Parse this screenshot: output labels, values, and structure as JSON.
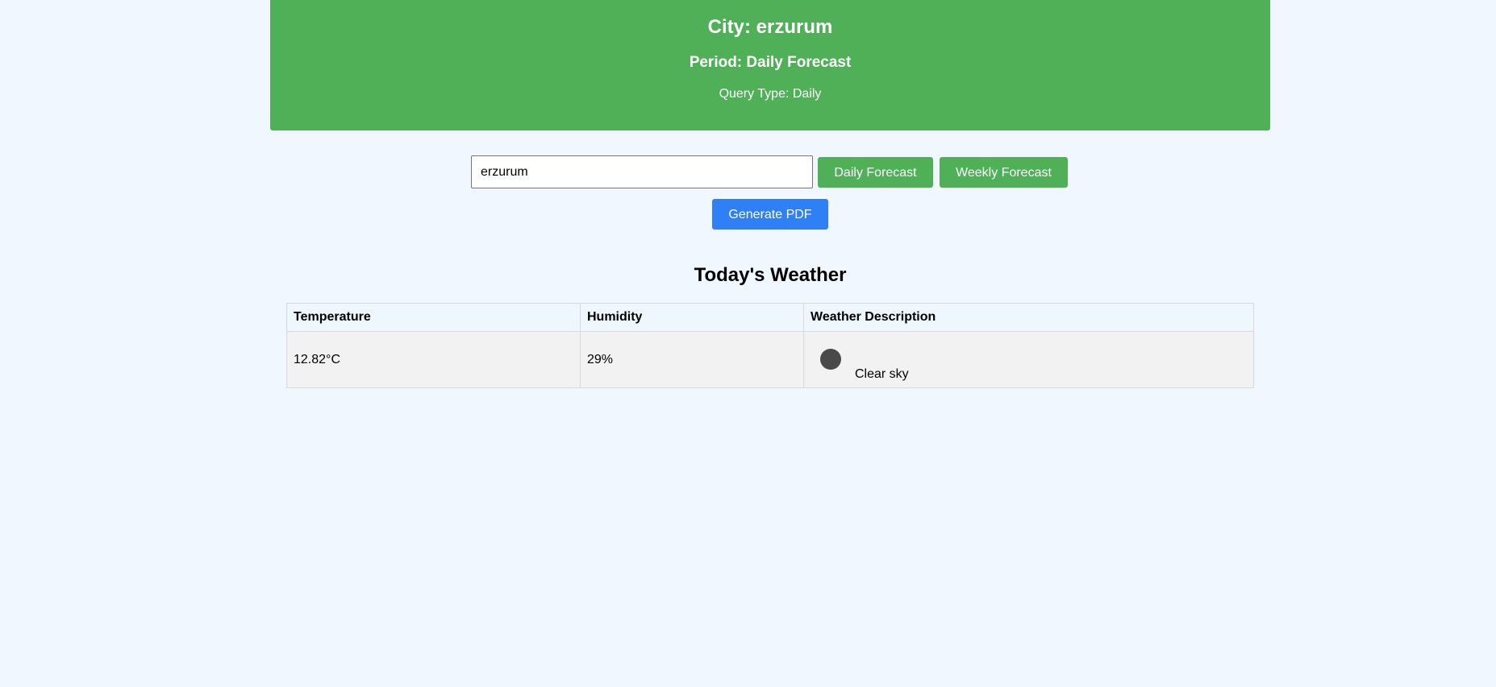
{
  "header": {
    "city": "City: erzurum",
    "period": "Period: Daily Forecast",
    "query_type": "Query Type: Daily"
  },
  "search": {
    "value": "erzurum",
    "placeholder": ""
  },
  "buttons": {
    "daily": "Daily Forecast",
    "weekly": "Weekly Forecast",
    "pdf": "Generate PDF"
  },
  "today": {
    "title": "Today's Weather",
    "columns": [
      "Temperature",
      "Humidity",
      "Weather Description"
    ],
    "row": {
      "temperature": "12.82°C",
      "humidity": "29%",
      "description": "Clear sky",
      "icon": "weather-icon"
    }
  },
  "colors": {
    "green": "#4fb057",
    "blue": "#2f80f7",
    "background": "#f0f7ff"
  }
}
